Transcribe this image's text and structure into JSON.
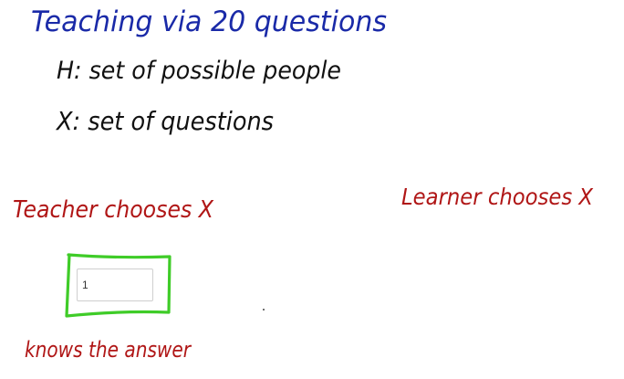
{
  "whiteboard": {
    "title": "Teaching via 20 questions",
    "line_h": "H: set of possible people",
    "line_x": "X: set of questions",
    "teacher_label": "Teacher chooses X",
    "learner_label": "Learner chooses X",
    "knows_label": "knows the answer",
    "answer_input_value": "1"
  },
  "colors": {
    "title_ink": "#1a2aa8",
    "body_ink": "#111111",
    "red_ink": "#b01616",
    "box_stroke": "#3fcc28"
  }
}
